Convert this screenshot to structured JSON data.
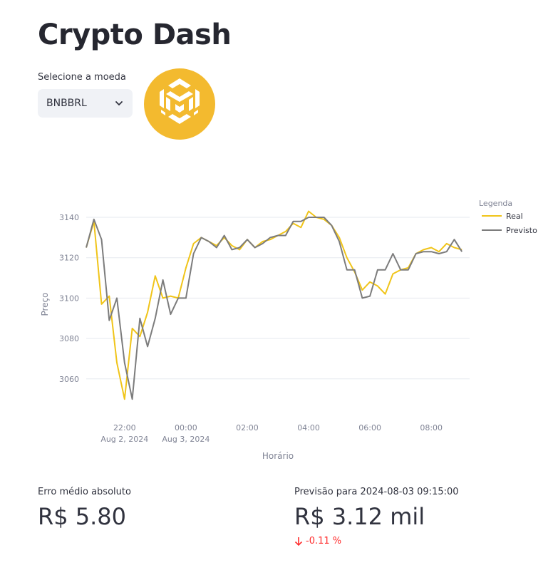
{
  "title": "Crypto Dash",
  "selector": {
    "label": "Selecione a moeda",
    "value": "BNBBRL"
  },
  "colors": {
    "real": "#f0c419",
    "previsto": "#7c7c7c",
    "brand": "#f3ba2f",
    "delta_negative": "#ff2b2b"
  },
  "metrics": {
    "mae": {
      "label": "Erro médio absoluto",
      "value": "R$ 5.80"
    },
    "forecast": {
      "label": "Previsão para 2024-08-03 09:15:00",
      "value": "R$ 3.12 mil",
      "delta": "-0.11 %"
    }
  },
  "chart_data": {
    "type": "line",
    "xlabel": "Horário",
    "ylabel": "Preço",
    "legend_title": "Legenda",
    "legend_position": "top-right",
    "grid": true,
    "xlim": [
      "2024-08-02 20:45",
      "2024-08-03 09:15"
    ],
    "ylim": [
      3043,
      3146
    ],
    "yticks": [
      3060,
      3080,
      3100,
      3120,
      3140
    ],
    "xticks": [
      {
        "t": "2024-08-02 22:00",
        "label": "22:00",
        "sub": "Aug 2, 2024"
      },
      {
        "t": "2024-08-03 00:00",
        "label": "00:00",
        "sub": "Aug 3, 2024"
      },
      {
        "t": "2024-08-03 02:00",
        "label": "02:00",
        "sub": ""
      },
      {
        "t": "2024-08-03 04:00",
        "label": "04:00",
        "sub": ""
      },
      {
        "t": "2024-08-03 06:00",
        "label": "06:00",
        "sub": ""
      },
      {
        "t": "2024-08-03 08:00",
        "label": "08:00",
        "sub": ""
      }
    ],
    "series": [
      {
        "name": "Real",
        "x": [
          "2024-08-02 20:45",
          "2024-08-02 21:00",
          "2024-08-02 21:15",
          "2024-08-02 21:30",
          "2024-08-02 21:45",
          "2024-08-02 22:00",
          "2024-08-02 22:15",
          "2024-08-02 22:30",
          "2024-08-02 22:45",
          "2024-08-02 23:00",
          "2024-08-02 23:15",
          "2024-08-02 23:30",
          "2024-08-02 23:45",
          "2024-08-03 00:00",
          "2024-08-03 00:15",
          "2024-08-03 00:30",
          "2024-08-03 00:45",
          "2024-08-03 01:00",
          "2024-08-03 01:15",
          "2024-08-03 01:30",
          "2024-08-03 01:45",
          "2024-08-03 02:00",
          "2024-08-03 02:15",
          "2024-08-03 02:30",
          "2024-08-03 02:45",
          "2024-08-03 03:00",
          "2024-08-03 03:15",
          "2024-08-03 03:30",
          "2024-08-03 03:45",
          "2024-08-03 04:00",
          "2024-08-03 04:15",
          "2024-08-03 04:30",
          "2024-08-03 04:45",
          "2024-08-03 05:00",
          "2024-08-03 05:15",
          "2024-08-03 05:30",
          "2024-08-03 05:45",
          "2024-08-03 06:00",
          "2024-08-03 06:15",
          "2024-08-03 06:30",
          "2024-08-03 06:45",
          "2024-08-03 07:00",
          "2024-08-03 07:15",
          "2024-08-03 07:30",
          "2024-08-03 07:45",
          "2024-08-03 08:00",
          "2024-08-03 08:15",
          "2024-08-03 08:30",
          "2024-08-03 08:45",
          "2024-08-03 09:00"
        ],
        "values": [
          3125,
          3138,
          3097,
          3101,
          3068,
          3050,
          3085,
          3081,
          3093,
          3111,
          3100,
          3101,
          3100,
          3115,
          3127,
          3130,
          3128,
          3126,
          3130,
          3126,
          3124,
          3129,
          3125,
          3128,
          3129,
          3131,
          3133,
          3137,
          3135,
          3143,
          3140,
          3139,
          3136,
          3130,
          3120,
          3113,
          3104,
          3108,
          3106,
          3102,
          3112,
          3114,
          3115,
          3122,
          3124,
          3125,
          3123,
          3127,
          3125,
          3124
        ]
      },
      {
        "name": "Previsto",
        "x": [
          "2024-08-02 20:45",
          "2024-08-02 21:00",
          "2024-08-02 21:15",
          "2024-08-02 21:30",
          "2024-08-02 21:45",
          "2024-08-02 22:00",
          "2024-08-02 22:15",
          "2024-08-02 22:30",
          "2024-08-02 22:45",
          "2024-08-02 23:00",
          "2024-08-02 23:15",
          "2024-08-02 23:30",
          "2024-08-02 23:45",
          "2024-08-03 00:00",
          "2024-08-03 00:15",
          "2024-08-03 00:30",
          "2024-08-03 00:45",
          "2024-08-03 01:00",
          "2024-08-03 01:15",
          "2024-08-03 01:30",
          "2024-08-03 01:45",
          "2024-08-03 02:00",
          "2024-08-03 02:15",
          "2024-08-03 02:30",
          "2024-08-03 02:45",
          "2024-08-03 03:00",
          "2024-08-03 03:15",
          "2024-08-03 03:30",
          "2024-08-03 03:45",
          "2024-08-03 04:00",
          "2024-08-03 04:15",
          "2024-08-03 04:30",
          "2024-08-03 04:45",
          "2024-08-03 05:00",
          "2024-08-03 05:15",
          "2024-08-03 05:30",
          "2024-08-03 05:45",
          "2024-08-03 06:00",
          "2024-08-03 06:15",
          "2024-08-03 06:30",
          "2024-08-03 06:45",
          "2024-08-03 07:00",
          "2024-08-03 07:15",
          "2024-08-03 07:30",
          "2024-08-03 07:45",
          "2024-08-03 08:00",
          "2024-08-03 08:15",
          "2024-08-03 08:30",
          "2024-08-03 08:45",
          "2024-08-03 09:00"
        ],
        "values": [
          3125,
          3139,
          3129,
          3089,
          3100,
          3068,
          3050,
          3090,
          3076,
          3090,
          3109,
          3092,
          3100,
          3100,
          3122,
          3130,
          3128,
          3125,
          3131,
          3124,
          3125,
          3129,
          3125,
          3127,
          3130,
          3131,
          3131,
          3138,
          3138,
          3140,
          3140,
          3140,
          3136,
          3128,
          3114,
          3114,
          3100,
          3101,
          3114,
          3114,
          3122,
          3114,
          3114,
          3122,
          3123,
          3123,
          3122,
          3123,
          3129,
          3123
        ]
      }
    ]
  }
}
